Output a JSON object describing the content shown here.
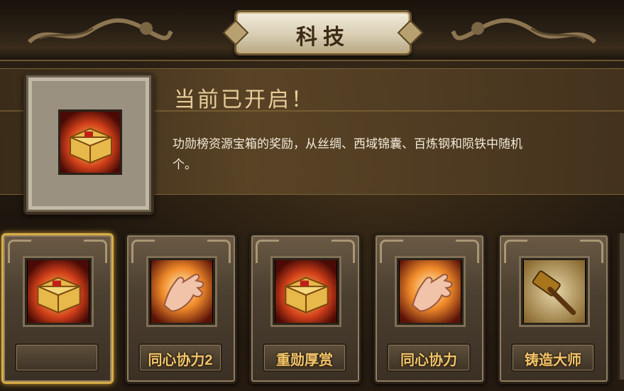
{
  "header": {
    "title": "科技"
  },
  "detail": {
    "icon": "treasure-chest-icon",
    "status": "当前已开启！",
    "description_line1": "功勋榜资源宝箱的奖励，从丝绸、西域锦囊、百炼钢和陨铁中随机",
    "description_line2": "个。"
  },
  "techs": [
    {
      "label": "",
      "icon": "treasure-chest-icon",
      "selected": true
    },
    {
      "label": "同心协力2",
      "icon": "flaming-palm-icon",
      "selected": false
    },
    {
      "label": "重勋厚赏",
      "icon": "treasure-chest-icon",
      "selected": false
    },
    {
      "label": "同心协力",
      "icon": "flaming-palm-icon",
      "selected": false
    },
    {
      "label": "铸造大师",
      "icon": "hammer-icon",
      "selected": false
    }
  ],
  "colors": {
    "accent_gold": "#f0c46a",
    "selected_border": "#d8ad45",
    "status_text": "#e8cc9a"
  }
}
